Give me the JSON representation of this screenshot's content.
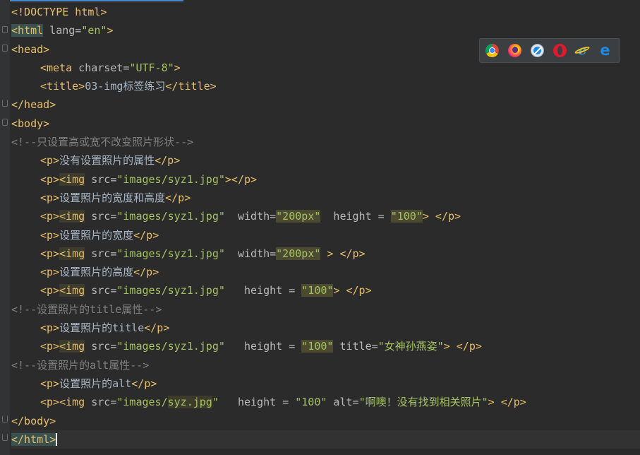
{
  "browser_bar": {
    "icons": [
      "chrome-icon",
      "firefox-icon",
      "safari-icon",
      "opera-icon",
      "internet-explorer-icon",
      "edge-icon"
    ],
    "ie_glyph": "e",
    "edge_glyph": "e"
  },
  "code": {
    "l1": "<!DOCTYPE html>",
    "l2_open": "<html",
    "l2_attr": " lang=",
    "l2_val": "\"en\"",
    "l2_close": ">",
    "l3": "<head>",
    "l4_open": "<meta",
    "l4_attr": " charset=",
    "l4_val": "\"UTF-8\"",
    "l4_close": ">",
    "l5_open": "<title>",
    "l5_text": "03-img标签练习",
    "l5_close": "</title>",
    "l6": "</head>",
    "l7": "<body>",
    "l8": "<!--只设置高或宽不改变照片形状-->",
    "l9_open": "<p>",
    "l9_text": "没有设置照片的属性",
    "l9_close": "</p>",
    "l10_p": "<p>",
    "l10_img": "<img",
    "l10_src": " src=",
    "l10_val": "\"images/syz1.jpg\"",
    "l10_close": "></p>",
    "l11_open": "<p>",
    "l11_text": "设置照片的宽度和高度",
    "l11_close": "</p>",
    "l12_p": "<p>",
    "l12_img": "<img",
    "l12_src": " src=",
    "l12_val": "\"images/syz1.jpg\"",
    "l12_w": "  width=",
    "l12_wv": "\"200px\"",
    "l12_h": "  height = ",
    "l12_hv": "\"100\"",
    "l12_close": "> </p>",
    "l13_open": "<p>",
    "l13_text": "设置照片的宽度",
    "l13_close": "</p>",
    "l14_p": "<p>",
    "l14_img": "<img",
    "l14_src": " src=",
    "l14_val": "\"images/syz1.jpg\"",
    "l14_w": "  width=",
    "l14_wv": "\"200px\"",
    "l14_close": " > </p>",
    "l15_open": "<p>",
    "l15_text": "设置照片的高度",
    "l15_close": "</p>",
    "l16_p": "<p>",
    "l16_img": "<img",
    "l16_src": " src=",
    "l16_val": "\"images/syz1.jpg\"",
    "l16_h": "   height = ",
    "l16_hv": "\"100\"",
    "l16_close": "> </p>",
    "l17": "<!--设置照片的title属性-->",
    "l18_open": "<p>",
    "l18_text": "设置照片的title",
    "l18_close": "</p>",
    "l19_p": "<p>",
    "l19_img": "<img",
    "l19_src": " src=",
    "l19_val": "\"images/syz1.jpg\"",
    "l19_h": "   height = ",
    "l19_hv": "\"100\"",
    "l19_t": " title=",
    "l19_tv": "\"女神孙燕姿\"",
    "l19_close": "> </p>",
    "l20": "<!--设置照片的alt属性-->",
    "l21_open": "<p>",
    "l21_text": "设置照片的alt",
    "l21_close": "</p>",
    "l22_p": "<p>",
    "l22_img": "<img",
    "l22_src": " src=",
    "l22_v1": "\"images/",
    "l22_v2": "syz.jpg",
    "l22_v3": "\"",
    "l22_h": "   height = ",
    "l22_hv": "\"100\"",
    "l22_a": " alt=",
    "l22_av": "\"啊噢！没有找到相关照片\"",
    "l22_close": "> </p>",
    "l23": "</body>",
    "l24": "</html>"
  }
}
